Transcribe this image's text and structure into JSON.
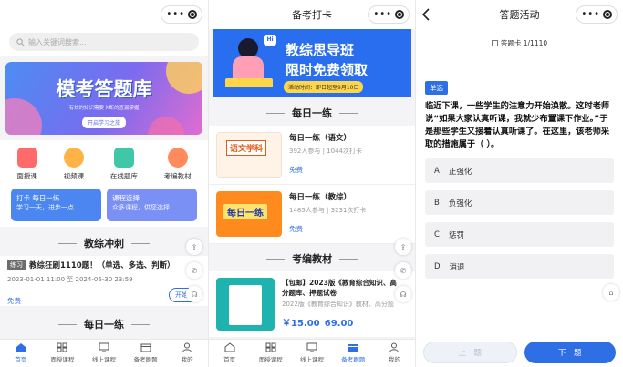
{
  "screen1": {
    "search_placeholder": "输入关键词搜索...",
    "banner": {
      "title": "模考答题库",
      "subtitle": "有效的知识需要卡断的查漏掌握",
      "button": "开启学习之旅"
    },
    "icons": [
      {
        "label": "面授课",
        "icon": "classroom-icon",
        "color": "#ff6b6b"
      },
      {
        "label": "视频课",
        "icon": "video-icon",
        "color": "#ffb347"
      },
      {
        "label": "在线题库",
        "icon": "question-bank-icon",
        "color": "#3fc7a8"
      },
      {
        "label": "考编教材",
        "icon": "textbook-icon",
        "color": "#ff8a5c"
      }
    ],
    "cards": [
      {
        "title": "打卡 每日一练",
        "sub": "学习一天，进步一点",
        "color": "#4c86f0"
      },
      {
        "title": "课程选择",
        "sub": "众多课程，供您选择",
        "color": "#6a8df3"
      }
    ],
    "section1": "教综冲刺",
    "practice": {
      "tag": "练习",
      "title": "教综狂刷1110题！（单选、多选、判断）",
      "date": "2023-01-01 11:00 至 2024-06-30 23:59",
      "free": "免费",
      "button": "开始练"
    },
    "section2": "每日一练",
    "tabs": [
      "首页",
      "面授课程",
      "线上课程",
      "备考刷题",
      "我的"
    ],
    "active_tab": 0
  },
  "screen2": {
    "title": "备考打卡",
    "banner": {
      "line1": "教综思导班",
      "line2": "限时免费领取",
      "note": "活动时间：即日起至9月10日",
      "hi": "Hi"
    },
    "section1": "每日一练",
    "items": [
      {
        "title": "每日一练（语文）",
        "meta": "392人参与 | 1044次打卡",
        "free": "免费",
        "thumb": "语文学科"
      },
      {
        "title": "每日一练（教综）",
        "meta": "1485人参与 | 3231次打卡",
        "free": "免费",
        "thumb": "每日一练"
      }
    ],
    "section2": "考编教材",
    "book": {
      "title": "【包邮】2023版《教育综合知识、高分题库、押题试卷",
      "meta": "2022版《教育综合知识》教材、高分题",
      "price": "￥15.00",
      "old_price": "69.00"
    },
    "tabs": [
      "首页",
      "面授课程",
      "线上课程",
      "备考刷题",
      "我的"
    ],
    "active_tab": 3
  },
  "screen3": {
    "title": "答题活动",
    "card_label": "答题卡 1/1110",
    "qtype": "单选",
    "question": "临近下课，一些学生的注意力开始涣散。这时老师说“如果大家认真听课，我就少布置课下作业。”于是那些学生又接着认真听课了。在这里，该老师采取的措施属于（    ）。",
    "options": [
      {
        "letter": "A",
        "text": "正强化"
      },
      {
        "letter": "B",
        "text": "负强化"
      },
      {
        "letter": "C",
        "text": "惩罚"
      },
      {
        "letter": "D",
        "text": "消退"
      }
    ],
    "prev": "上一题",
    "next": "下一题"
  }
}
